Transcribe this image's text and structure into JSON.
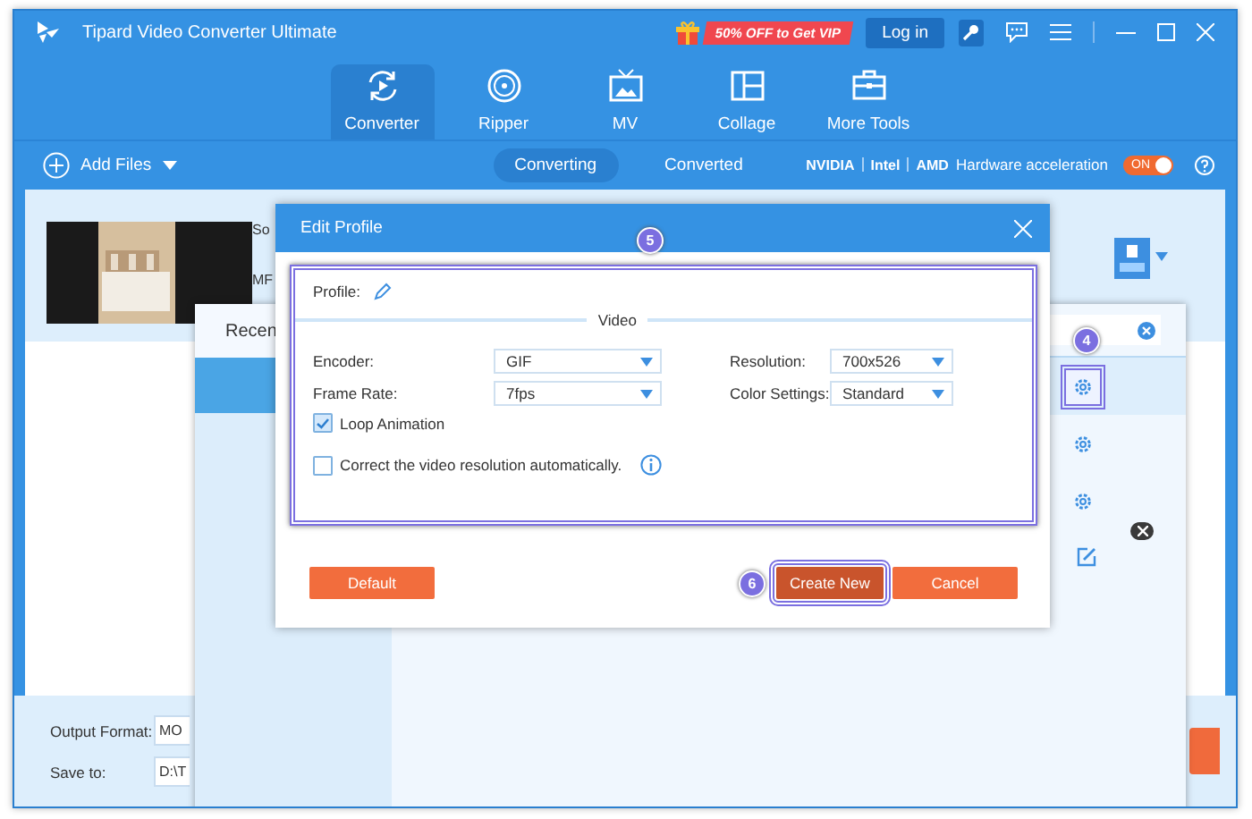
{
  "window": {
    "title": "Tipard Video Converter Ultimate"
  },
  "promo": {
    "label": "50% OFF to Get VIP"
  },
  "login_button": "Log in",
  "nav_tabs": [
    {
      "label": "Converter",
      "selected": true
    },
    {
      "label": "Ripper",
      "selected": false
    },
    {
      "label": "MV",
      "selected": false
    },
    {
      "label": "Collage",
      "selected": false
    },
    {
      "label": "More Tools",
      "selected": false
    }
  ],
  "toolbar": {
    "add_files": "Add Files",
    "view_tabs": [
      {
        "label": "Converting",
        "selected": true
      },
      {
        "label": "Converted",
        "selected": false
      }
    ],
    "gpu_brands": [
      "NVIDIA",
      "Intel",
      "AMD"
    ],
    "hardware_acceleration": {
      "label": "Hardware acceleration",
      "on": true,
      "state_text": "ON"
    }
  },
  "file_row": {
    "labels": [
      "So",
      "MF"
    ]
  },
  "format_panel": {
    "tab": "Recen",
    "callout": "4",
    "rows": [
      {
        "selected": true,
        "highlighted": true
      },
      {
        "selected": false,
        "highlighted": false
      },
      {
        "selected": false,
        "highlighted": false
      }
    ]
  },
  "bottom": {
    "output_format_label": "Output Format:",
    "output_format_value": "MO",
    "save_to_label": "Save to:",
    "save_to_value": "D:\\T"
  },
  "edit_profile": {
    "title": "Edit Profile",
    "callout": "5",
    "highlighted": true,
    "profile_label": "Profile:",
    "section": "Video",
    "settings": [
      {
        "label": "Encoder:",
        "value": "GIF"
      },
      {
        "label": "Resolution:",
        "value": "700x526"
      },
      {
        "label": "Frame Rate:",
        "value": "7fps"
      },
      {
        "label": "Color Settings:",
        "value": "Standard"
      }
    ],
    "options": [
      {
        "label": "Loop Animation",
        "checked": true
      },
      {
        "label": "Correct the video resolution automatically.",
        "checked": false
      }
    ],
    "buttons": [
      {
        "label": "Default",
        "highlighted": false
      },
      {
        "label": "Create New",
        "highlighted": true,
        "callout": "6"
      },
      {
        "label": "Cancel",
        "highlighted": false
      }
    ]
  }
}
